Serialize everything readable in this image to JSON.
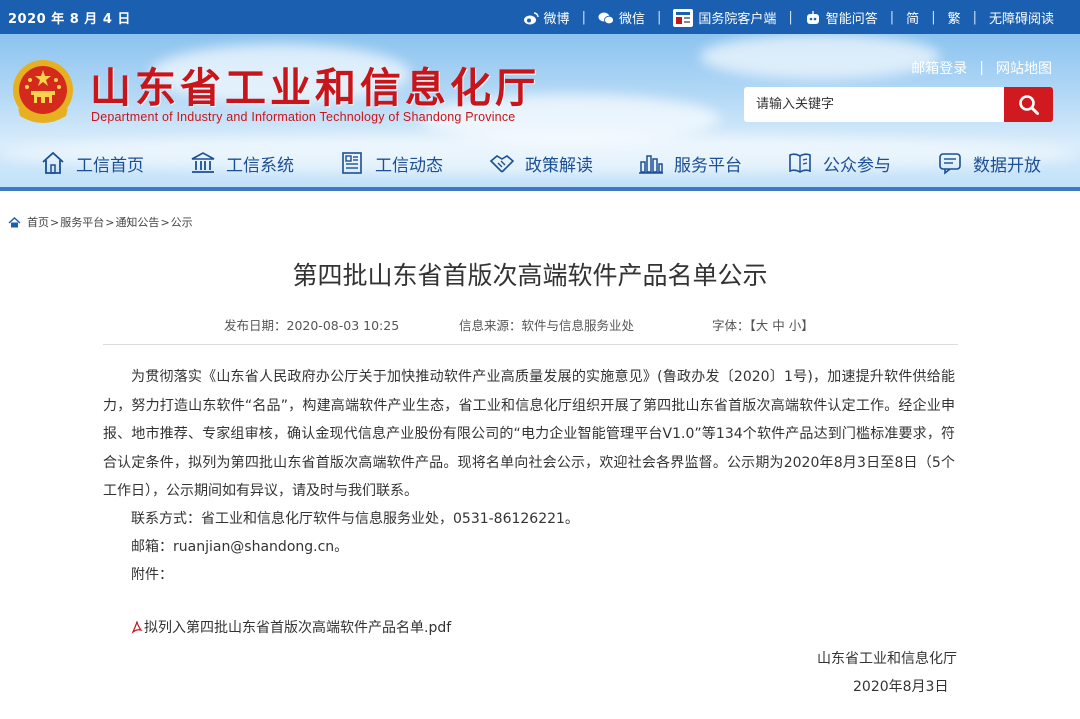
{
  "topbar": {
    "date": "2020 年 8 月 4 日",
    "links": [
      {
        "icon": "weibo-icon",
        "label": "微博"
      },
      {
        "icon": "wechat-icon",
        "label": "微信"
      },
      {
        "icon": "state-council-app-icon",
        "label": "国务院客户端"
      },
      {
        "icon": "robot-icon",
        "label": "智能问答"
      },
      {
        "label": "简"
      },
      {
        "label": "繁"
      },
      {
        "label": "无障碍阅读"
      }
    ]
  },
  "header": {
    "title_cn": "山东省工业和信息化厅",
    "title_en": "Department of Industry and Information Technology of Shandong Province",
    "mail_login": "邮箱登录",
    "sitemap": "网站地图",
    "search_placeholder": "请输入关键字"
  },
  "nav": [
    {
      "label": "工信首页",
      "icon": "home-icon"
    },
    {
      "label": "工信系统",
      "icon": "building-icon"
    },
    {
      "label": "工信动态",
      "icon": "news-icon"
    },
    {
      "label": "政策解读",
      "icon": "handshake-icon"
    },
    {
      "label": "服务平台",
      "icon": "city-chart-icon"
    },
    {
      "label": "公众参与",
      "icon": "book-icon"
    },
    {
      "label": "数据开放",
      "icon": "chat-icon"
    }
  ],
  "breadcrumb": [
    "首页",
    "服务平台",
    "通知公告",
    "公示"
  ],
  "breadcrumb_sep": ">",
  "article": {
    "title": "第四批山东省首版次高端软件产品名单公示",
    "publish_date": "发布日期：2020-08-03 10:25",
    "source": "信息来源：软件与信息服务业处",
    "font_size": "字体：【大 中 小】",
    "paragraph": "为贯彻落实《山东省人民政府办公厅关于加快推动软件产业高质量发展的实施意见》(鲁政办发〔2020〕1号)，加速提升软件供给能力，努力打造山东软件“名品”，构建高端软件产业生态，省工业和信息化厅组织开展了第四批山东省首版次高端软件认定工作。经企业申报、地市推荐、专家组审核，确认金现代信息产业股份有限公司的“电力企业智能管理平台V1.0”等134个软件产品达到门槛标准要求，符合认定条件，拟列为第四批山东省首版次高端软件产品。现将名单向社会公示，欢迎社会各界监督。公示期为2020年8月3日至8日（5个工作日），公示期间如有异议，请及时与我们联系。",
    "contact": "联系方式：省工业和信息化厅软件与信息服务业处，0531-86126221。",
    "email": "邮箱：ruanjian@shandong.cn。",
    "attachment_label": "附件：",
    "attachment_file": "拟列入第四批山东省首版次高端软件产品名单.pdf",
    "signer": "山东省工业和信息化厅",
    "sign_date": "2020年8月3日"
  },
  "colors": {
    "top_bar": "#1b5fb0",
    "title_red": "#c8151b",
    "nav_blue": "#1c4f94",
    "search_button": "#d01a1f"
  }
}
